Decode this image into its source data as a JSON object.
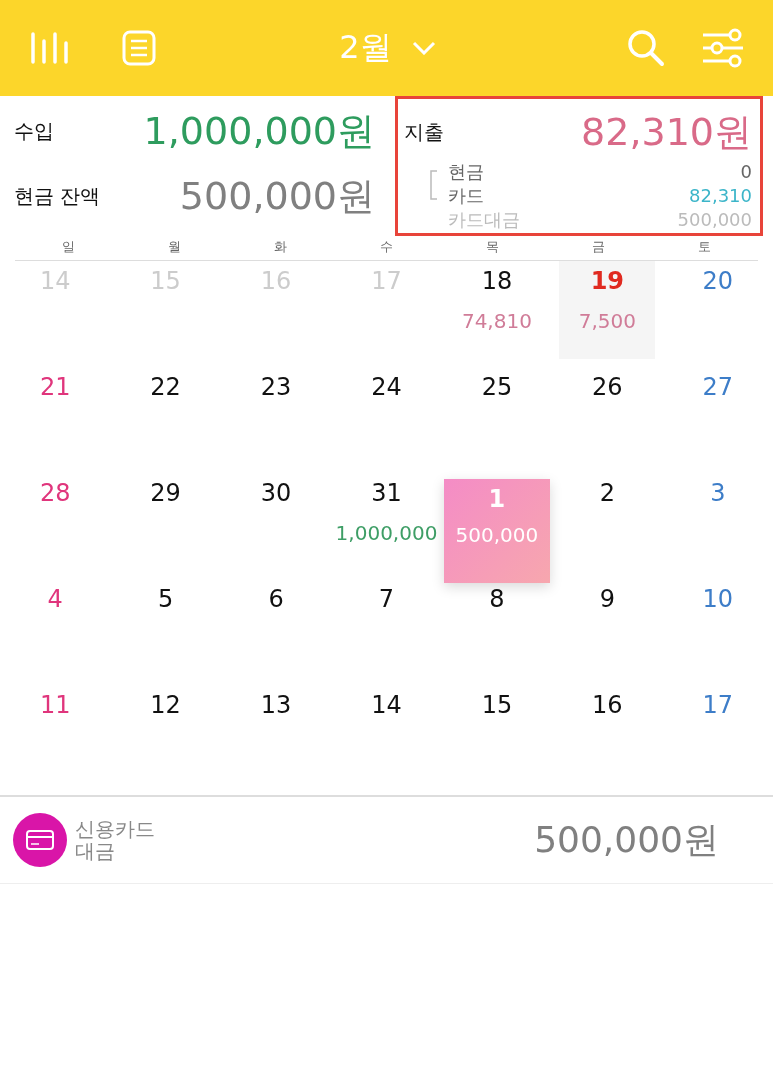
{
  "header": {
    "month": "2월"
  },
  "summary": {
    "income_label": "수입",
    "income": "1,000,000원",
    "balance_label": "현금 잔액",
    "balance": "500,000원",
    "expense_label": "지출",
    "expense": "82,310원",
    "highlighted": true,
    "breakdown": [
      {
        "label": "현금",
        "value": "0",
        "kind": "cash"
      },
      {
        "label": "카드",
        "value": "82,310",
        "kind": "card"
      },
      {
        "label": "카드대금",
        "value": "500,000",
        "kind": "bill"
      }
    ]
  },
  "weekdays": [
    "일",
    "월",
    "화",
    "수",
    "목",
    "금",
    "토"
  ],
  "weeks": [
    [
      {
        "day": "14",
        "kind": "faded",
        "selected": false
      },
      {
        "day": "15",
        "kind": "faded",
        "selected": false
      },
      {
        "day": "16",
        "kind": "faded",
        "selected": false
      },
      {
        "day": "17",
        "kind": "faded",
        "selected": false
      },
      {
        "day": "18",
        "kind": "weekday",
        "selected": false,
        "amount": {
          "text": "74,810",
          "kind": "expense"
        }
      },
      {
        "day": "19",
        "kind": "today",
        "selected": false,
        "amount": {
          "text": "7,500",
          "kind": "expense"
        }
      },
      {
        "day": "20",
        "kind": "saturday",
        "selected": false
      }
    ],
    [
      {
        "day": "21",
        "kind": "sunday",
        "selected": false
      },
      {
        "day": "22",
        "kind": "weekday",
        "selected": false
      },
      {
        "day": "23",
        "kind": "weekday",
        "selected": false
      },
      {
        "day": "24",
        "kind": "weekday",
        "selected": false
      },
      {
        "day": "25",
        "kind": "weekday",
        "selected": false
      },
      {
        "day": "26",
        "kind": "weekday",
        "selected": false
      },
      {
        "day": "27",
        "kind": "saturday",
        "selected": false
      }
    ],
    [
      {
        "day": "28",
        "kind": "sunday",
        "selected": false
      },
      {
        "day": "29",
        "kind": "weekday",
        "selected": false
      },
      {
        "day": "30",
        "kind": "weekday",
        "selected": false
      },
      {
        "day": "31",
        "kind": "weekday",
        "selected": false,
        "amount": {
          "text": "1,000,000",
          "kind": "income"
        }
      },
      {
        "day": "1",
        "kind": "weekday",
        "selected": true,
        "amount": {
          "text": "500,000",
          "kind": "bill"
        }
      },
      {
        "day": "2",
        "kind": "weekday",
        "selected": false
      },
      {
        "day": "3",
        "kind": "saturday",
        "selected": false
      }
    ],
    [
      {
        "day": "4",
        "kind": "sunday",
        "selected": false
      },
      {
        "day": "5",
        "kind": "weekday",
        "selected": false
      },
      {
        "day": "6",
        "kind": "weekday",
        "selected": false
      },
      {
        "day": "7",
        "kind": "weekday",
        "selected": false
      },
      {
        "day": "8",
        "kind": "weekday",
        "selected": false
      },
      {
        "day": "9",
        "kind": "weekday",
        "selected": false
      },
      {
        "day": "10",
        "kind": "saturday",
        "selected": false
      }
    ],
    [
      {
        "day": "11",
        "kind": "sunday",
        "selected": false
      },
      {
        "day": "12",
        "kind": "weekday",
        "selected": false
      },
      {
        "day": "13",
        "kind": "weekday",
        "selected": false
      },
      {
        "day": "14",
        "kind": "weekday",
        "selected": false
      },
      {
        "day": "15",
        "kind": "weekday",
        "selected": false
      },
      {
        "day": "16",
        "kind": "weekday",
        "selected": false
      },
      {
        "day": "17",
        "kind": "saturday",
        "selected": false
      }
    ]
  ],
  "entries": [
    {
      "title": "신용카드\n대금",
      "amount": "500,000원"
    }
  ]
}
